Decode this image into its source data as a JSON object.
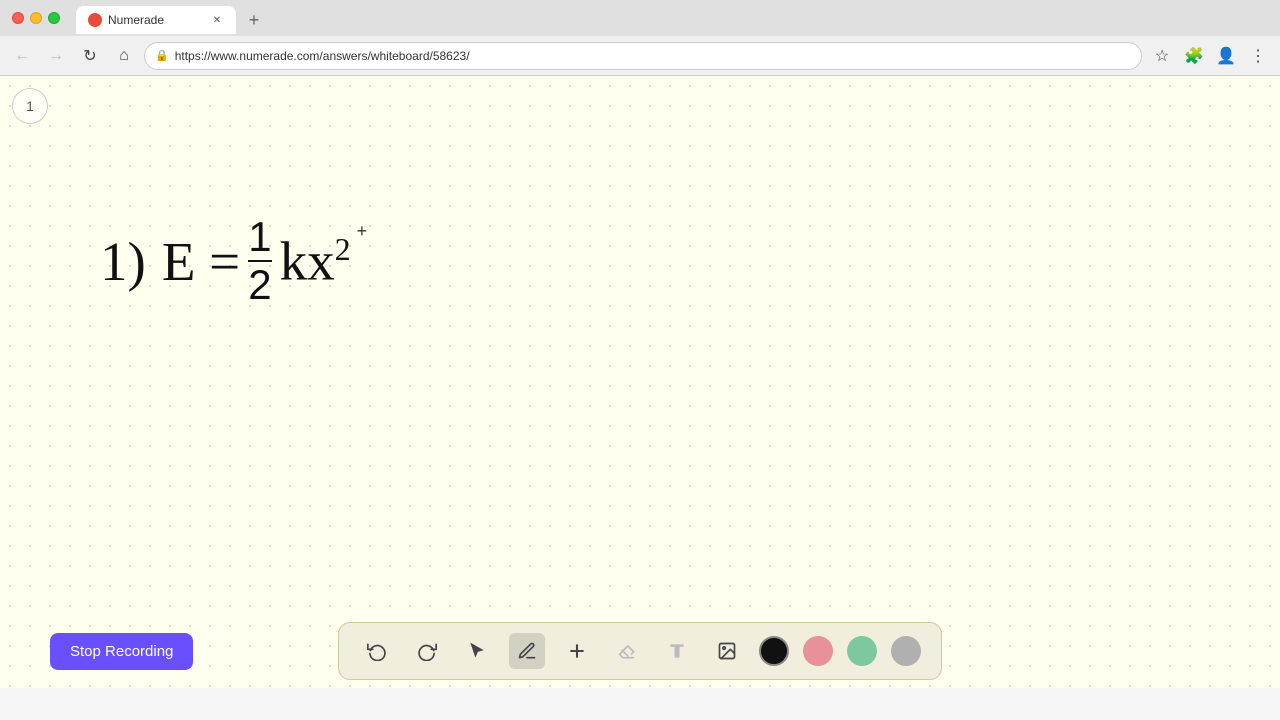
{
  "browser": {
    "title": "Numerade",
    "url": "https://www.numerade.com/answers/whiteboard/58623/",
    "tab_label": "Numerade",
    "new_tab_label": "+"
  },
  "nav": {
    "back_title": "Back",
    "forward_title": "Forward",
    "refresh_title": "Refresh",
    "home_title": "Home"
  },
  "page": {
    "page_number": "1"
  },
  "math": {
    "equation": "E = ½kx²",
    "prefix": "1)"
  },
  "toolbar": {
    "undo_label": "Undo",
    "redo_label": "Redo",
    "select_label": "Select",
    "pen_label": "Pen",
    "add_label": "Add",
    "eraser_label": "Eraser",
    "text_label": "Text",
    "image_label": "Image",
    "colors": [
      {
        "name": "black",
        "hex": "#111111",
        "active": true
      },
      {
        "name": "pink",
        "hex": "#e8919a"
      },
      {
        "name": "green",
        "hex": "#7ec8a0"
      },
      {
        "name": "gray",
        "hex": "#b0b0b0"
      }
    ]
  },
  "stop_recording": {
    "label": "Stop Recording"
  }
}
